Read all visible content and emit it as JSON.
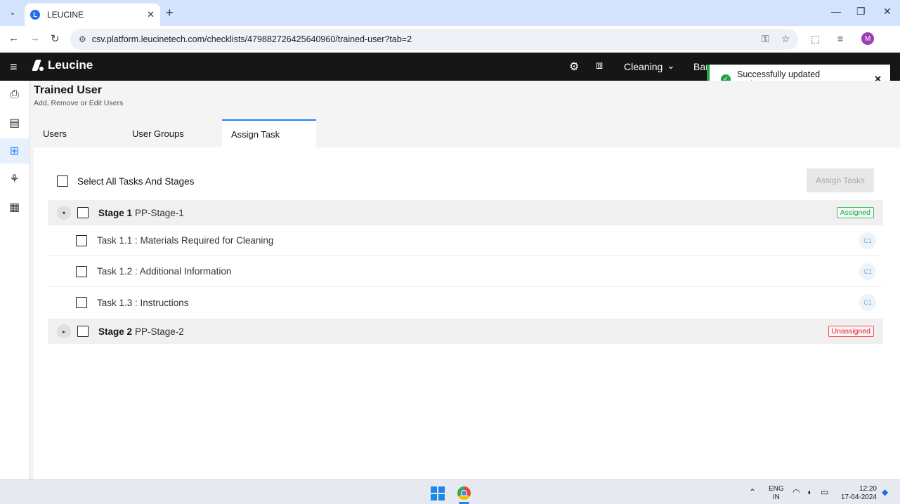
{
  "browser": {
    "tab_title": "LEUCINE",
    "favicon_letter": "L",
    "url": "csv.platform.leucinetech.com/checklists/479882726425640960/trained-user?tab=2",
    "profile_initial": "M",
    "icons": {
      "tab_dropdown": "⌄",
      "tab_close": "✕",
      "new_tab": "+",
      "minimize": "—",
      "maximize": "❐",
      "close": "✕",
      "back": "←",
      "forward": "→",
      "reload": "↻",
      "site_info": "⚙",
      "password": "⚿",
      "bookmark": "☆",
      "extensions": "⬚",
      "media": "≡"
    }
  },
  "app": {
    "logo_text": "Leucine",
    "hamburger": "≡",
    "settings_icon": "⚙",
    "scan_icon": "⧈",
    "facility": "Cleaning",
    "facility_chevron": "⌄",
    "header_partial": "Bar"
  },
  "toast": {
    "check": "✓",
    "message": "Successfully updated assignments.",
    "close": "✕"
  },
  "rail": {
    "inbox": "⎙",
    "checklist": "▤",
    "ontology": "⊞",
    "hierarchy": "⚘",
    "calculator": "▦"
  },
  "page": {
    "title": "Trained User",
    "subtitle": "Add, Remove or Edit Users",
    "tabs": [
      "Users",
      "User Groups",
      "Assign Task"
    ]
  },
  "assign": {
    "select_all_label": "Select All Tasks And Stages",
    "assign_button": "Assign Tasks",
    "stages": [
      {
        "number": "Stage 1",
        "name": "PP-Stage-1",
        "status": "Assigned",
        "toggle": "▾",
        "tasks": [
          {
            "label": "Task 1.1 : Materials Required for Cleaning",
            "chip": "C1"
          },
          {
            "label": "Task 1.2 : Additional Information",
            "chip": "C1"
          },
          {
            "label": "Task 1.3 : Instructions",
            "chip": "C1"
          }
        ]
      },
      {
        "number": "Stage 2",
        "name": "PP-Stage-2",
        "status": "Unassigned",
        "toggle": "▸"
      }
    ]
  },
  "taskbar": {
    "tray_up": "⌃",
    "lang_top": "ENG",
    "lang_bottom": "IN",
    "wifi": "◠",
    "volume": "◖",
    "battery": "▭",
    "time": "12:20",
    "date": "17-04-2024",
    "notification": "◆"
  },
  "colors": {
    "accent": "#1d84ff",
    "success": "#24a148",
    "danger": "#da1e28",
    "appbar": "#161616"
  }
}
